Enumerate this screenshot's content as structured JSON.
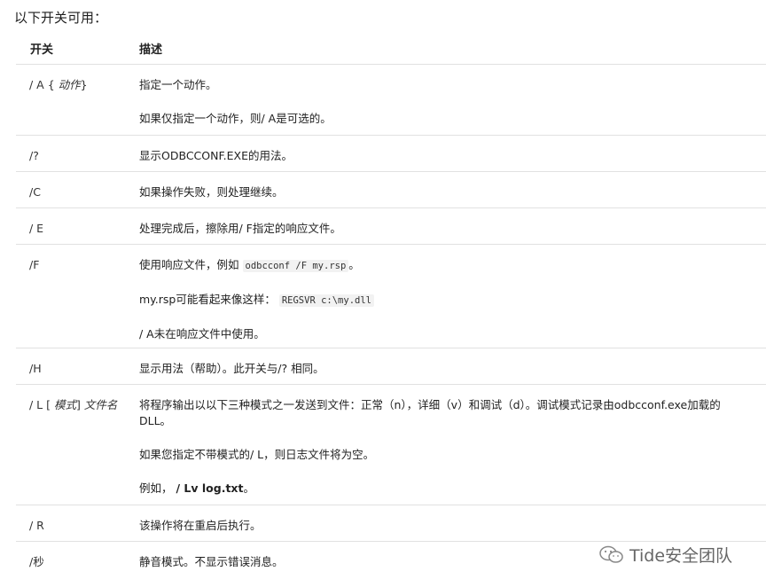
{
  "intro": "以下开关可用：",
  "headers": {
    "switch": "开关",
    "description": "描述"
  },
  "rows": [
    {
      "sw_pre": "/ A {",
      "sw_it": "动作",
      "sw_post": "}",
      "d1": "指定一个动作。",
      "d2": "如果仅指定一个动作，则/ A是可选的。"
    },
    {
      "sw": "/?",
      "d1": "显示ODBCCONF.EXE的用法。"
    },
    {
      "sw": "/C",
      "d1": "如果操作失败，则处理继续。"
    },
    {
      "sw": "/ E",
      "d1": "处理完成后，擦除用/ F指定的响应文件。"
    },
    {
      "sw": "/F",
      "d1_text": "使用响应文件，例如",
      "d1_code": "odbcconf /F my.rsp",
      "d1_end": "。",
      "d2_text": "my.rsp可能看起来像这样：",
      "d2_code": "REGSVR c:\\my.dll",
      "d3": "/ A未在响应文件中使用。"
    },
    {
      "sw": "/H",
      "d1": "显示用法（帮助）。此开关与/? 相同。"
    },
    {
      "sw_pre": "/ L [",
      "sw_it": "模式",
      "sw_mid": "]",
      "sw_it2": "文件名",
      "d1": "将程序输出以以下三种模式之一发送到文件：正常（n），详细（v）和调试（d）。调试模式记录由odbcconf.exe加载的DLL。",
      "d2": "如果您指定不带模式的/ L，则日志文件将为空。",
      "d3_text": "例如，",
      "d3_bold": "/ Lv log.txt",
      "d3_end": "。"
    },
    {
      "sw": "/ R",
      "d1": "该操作将在重启后执行。"
    },
    {
      "sw": "/秒",
      "d1": "静音模式。不显示错误消息。"
    }
  ],
  "watermark": {
    "text": "Tide安全团队",
    "icon": "wechat-icon"
  }
}
